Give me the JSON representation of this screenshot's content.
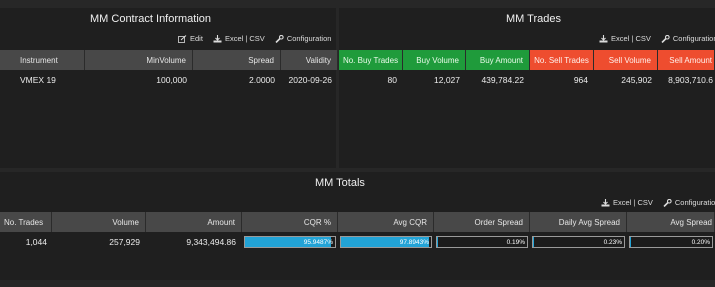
{
  "contract": {
    "title": "MM Contract Information",
    "toolbar": {
      "edit": "Edit",
      "excel_csv": "Excel | CSV",
      "configuration": "Configuration"
    },
    "columns": [
      "Instrument",
      "MinVolume",
      "Spread",
      "Validity"
    ],
    "rows": [
      [
        "VMEX 19",
        "100,000",
        "2.0000",
        "2020-09-26"
      ]
    ]
  },
  "trades": {
    "title": "MM Trades",
    "toolbar": {
      "excel_csv": "Excel | CSV",
      "configuration": "Configuration"
    },
    "columns": [
      "No. Buy Trades",
      "Buy Volume",
      "Buy Amount",
      "No. Sell Trades",
      "Sell Volume",
      "Sell Amount"
    ],
    "rows": [
      [
        "80",
        "12,027",
        "439,784.22",
        "964",
        "245,902",
        "8,903,710.6"
      ]
    ]
  },
  "totals": {
    "title": "MM Totals",
    "toolbar": {
      "excel_csv": "Excel | CSV",
      "configuration": "Configuration"
    },
    "columns": [
      "No. Trades",
      "Volume",
      "Amount",
      "CQR %",
      "Avg CQR",
      "Order Spread",
      "Daily Avg Spread",
      "Avg Spread"
    ],
    "row": {
      "no_trades": "1,044",
      "volume": "257,929",
      "amount": "9,343,494.86",
      "cqr": {
        "label": "95.9487%",
        "value": 0.959487
      },
      "avg_cqr": {
        "label": "97.8943%",
        "value": 0.978943
      },
      "order_spread": {
        "label": "0.19%",
        "value": 0.0019
      },
      "daily_avg_spread": {
        "label": "0.23%",
        "value": 0.0023
      },
      "avg_spread": {
        "label": "0.20%",
        "value": 0.002
      }
    }
  },
  "colors": {
    "buy_header": "#1f9b3b",
    "sell_header": "#ee4d2f",
    "bar_fill": "#22a3d6",
    "header_bg": "#484848",
    "panel_bg": "#1f1f1f",
    "page_bg": "#272727"
  },
  "icons": {
    "edit": "edit-icon",
    "download": "download-icon",
    "wrench": "wrench-icon"
  }
}
